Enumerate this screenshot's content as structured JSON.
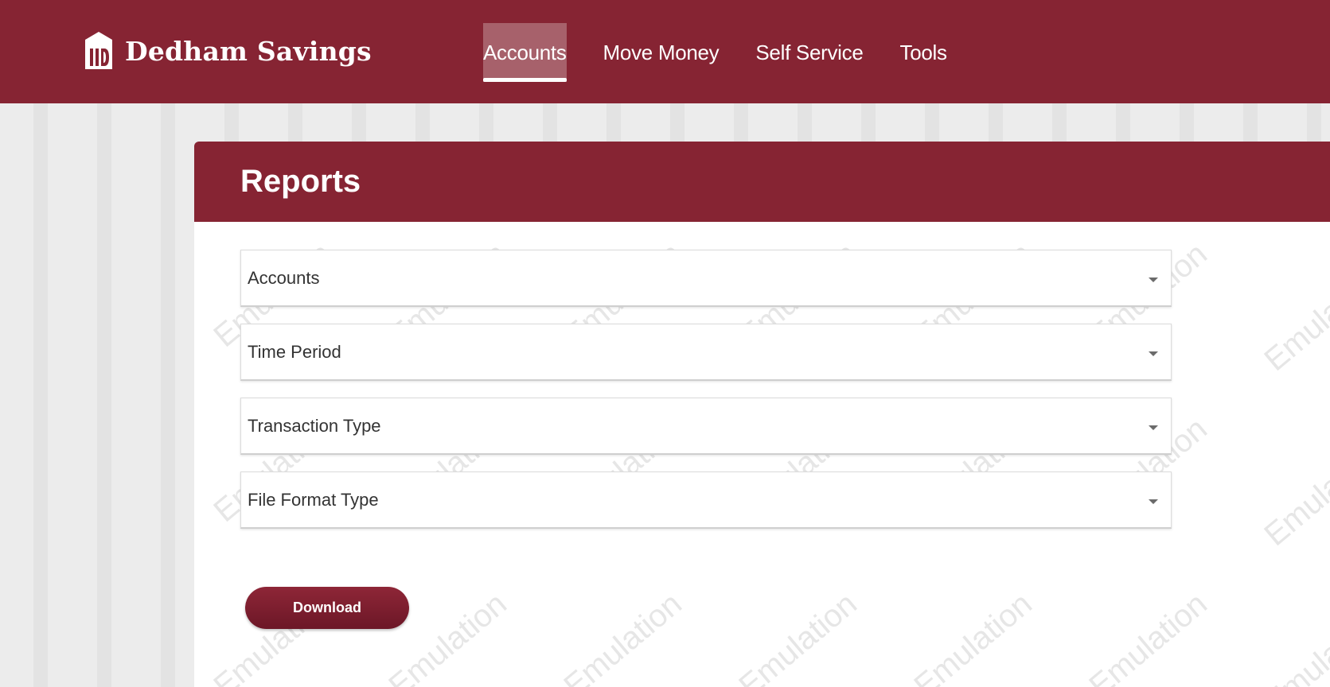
{
  "brand": {
    "name": "Dedham Savings",
    "logo_icon": "bank-building-icon"
  },
  "nav": {
    "items": [
      {
        "label": "Accounts",
        "active": true
      },
      {
        "label": "Move Money",
        "active": false
      },
      {
        "label": "Self Service",
        "active": false
      },
      {
        "label": "Tools",
        "active": false
      }
    ]
  },
  "page": {
    "title": "Reports"
  },
  "form": {
    "fields": [
      {
        "label": "Accounts"
      },
      {
        "label": "Time Period"
      },
      {
        "label": "Transaction Type"
      },
      {
        "label": "File Format Type"
      }
    ],
    "download_label": "Download"
  },
  "colors": {
    "brand": "#862433",
    "background": "#ececec",
    "button": "#7a1d2e"
  },
  "watermark_text": "Emulation"
}
